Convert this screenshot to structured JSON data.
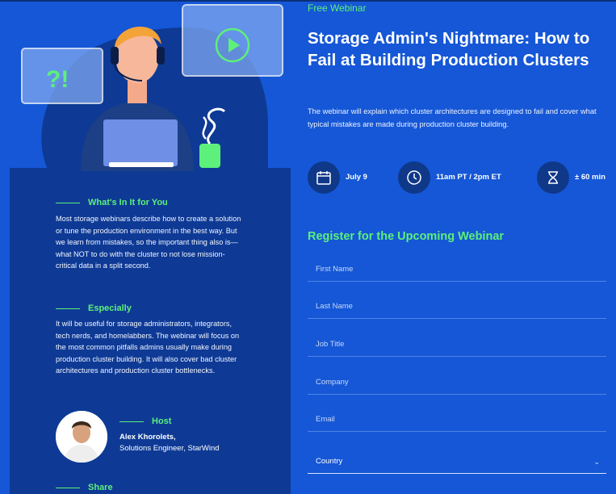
{
  "illustration": {
    "alert_text": "?!"
  },
  "sidebar": {
    "sections": [
      {
        "title": "What's In It for You",
        "text": "Most storage webinars describe how to create a solution or tune the production environment in the best way. But we learn from mistakes, so the important thing also is—what NOT to do with the cluster to not lose mission-critical data in a split second."
      },
      {
        "title": "Especially",
        "text": "It will be useful for storage administrators, integrators, tech nerds, and homelabbers. The webinar will focus on the most common pitfalls admins usually make during production cluster building. It will also cover bad cluster architectures and production cluster bottlenecks."
      }
    ],
    "host": {
      "title": "Host",
      "name": "Alex Khorolets,",
      "role": "Solutions Engineer, StarWind"
    },
    "share_title": "Share"
  },
  "header": {
    "tag": "Free Webinar",
    "title": "Storage Admin's Nightmare: How to Fail at Building Production Clusters",
    "description": "The webinar will explain which cluster architectures are designed to fail and cover what typical mistakes are made during production cluster building."
  },
  "meta": {
    "date": "July 9",
    "time": "11am PT / 2pm ET",
    "duration": "± 60 min"
  },
  "form": {
    "title": "Register for the Upcoming Webinar",
    "fields": [
      "First Name",
      "Last Name",
      "Job Title",
      "Company",
      "Email"
    ],
    "country_placeholder": "Country"
  },
  "colors": {
    "background": "#1557d6",
    "panel": "#0e3a95",
    "accent": "#5df07a"
  },
  "icons": [
    "calendar-icon",
    "clock-icon",
    "hourglass-icon",
    "chevron-down-icon",
    "play-icon",
    "headset-icon"
  ]
}
